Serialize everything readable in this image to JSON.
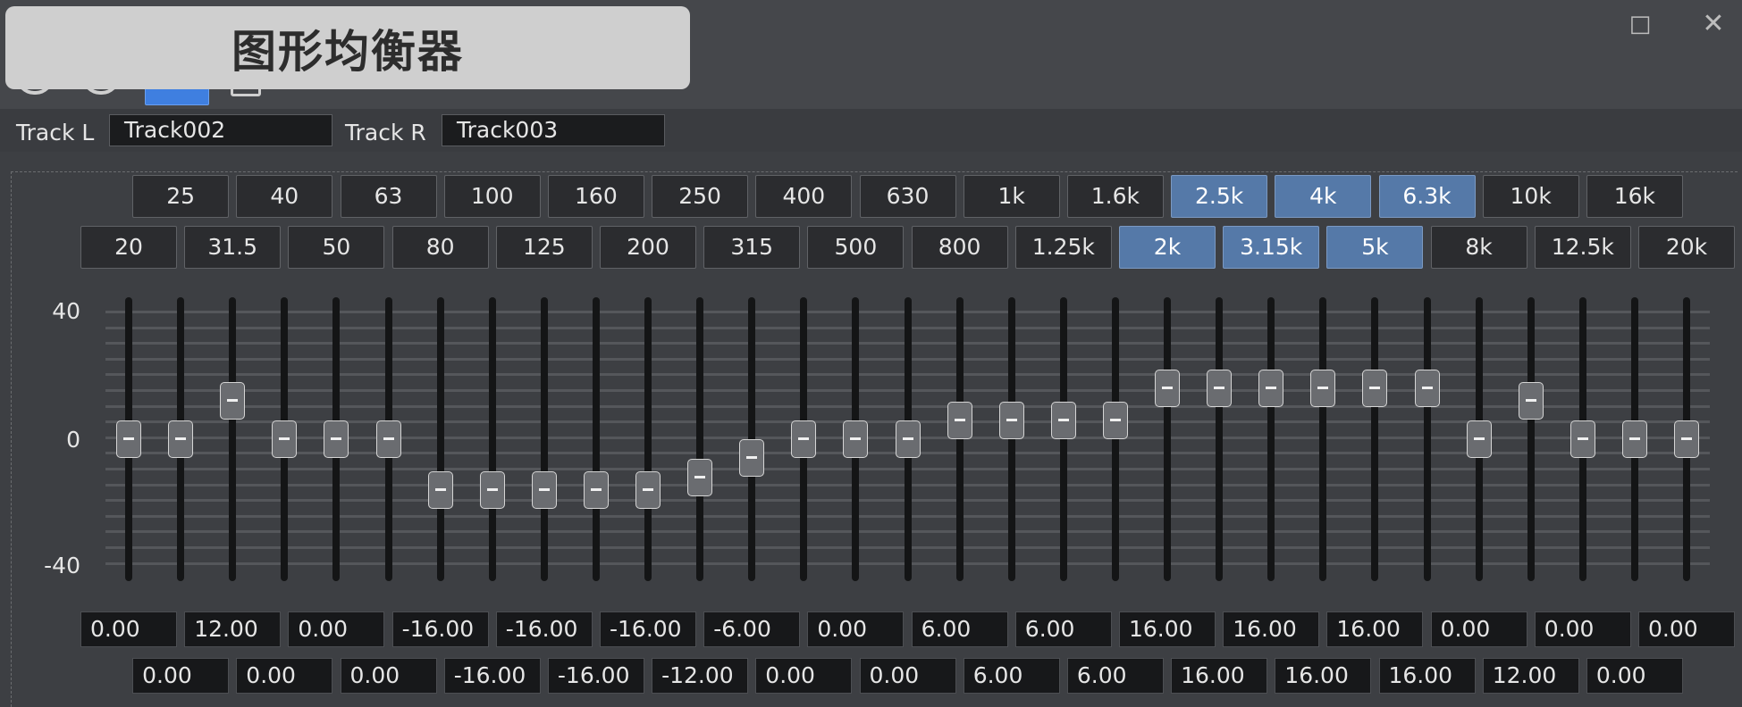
{
  "window": {
    "title": "图形均衡器"
  },
  "toolbar": {
    "undo_icon": "undo-icon",
    "redo_icon": "redo-icon",
    "active_icon": "active-mode-icon",
    "copy_icon": "copy-icon"
  },
  "window_controls": {
    "maximize": "□",
    "close": "✕"
  },
  "tracks": {
    "left_label": "Track L",
    "left_value": "Track002",
    "right_label": "Track R",
    "right_value": "Track003"
  },
  "scale": {
    "top": "40",
    "mid": "0",
    "bottom": "-40",
    "max": 40,
    "min": -40
  },
  "colors": {
    "selected": "#5579a8",
    "accent": "#3f7fe0"
  },
  "bands": [
    {
      "freq": "20",
      "gain": "0.00",
      "value": 0,
      "row": "lower",
      "selected": false
    },
    {
      "freq": "25",
      "gain": "0.00",
      "value": 0,
      "row": "upper",
      "selected": false
    },
    {
      "freq": "31.5",
      "gain": "12.00",
      "value": 12,
      "row": "lower",
      "selected": false
    },
    {
      "freq": "40",
      "gain": "0.00",
      "value": 0,
      "row": "upper",
      "selected": false
    },
    {
      "freq": "50",
      "gain": "0.00",
      "value": 0,
      "row": "lower",
      "selected": false
    },
    {
      "freq": "63",
      "gain": "0.00",
      "value": 0,
      "row": "upper",
      "selected": false
    },
    {
      "freq": "80",
      "gain": "-16.00",
      "value": -16,
      "row": "lower",
      "selected": false
    },
    {
      "freq": "100",
      "gain": "-16.00",
      "value": -16,
      "row": "upper",
      "selected": false
    },
    {
      "freq": "125",
      "gain": "-16.00",
      "value": -16,
      "row": "lower",
      "selected": false
    },
    {
      "freq": "160",
      "gain": "-16.00",
      "value": -16,
      "row": "upper",
      "selected": false
    },
    {
      "freq": "200",
      "gain": "-16.00",
      "value": -16,
      "row": "lower",
      "selected": false
    },
    {
      "freq": "250",
      "gain": "-12.00",
      "value": -12,
      "row": "upper",
      "selected": false
    },
    {
      "freq": "315",
      "gain": "-6.00",
      "value": -6,
      "row": "lower",
      "selected": false
    },
    {
      "freq": "400",
      "gain": "0.00",
      "value": 0,
      "row": "upper",
      "selected": false
    },
    {
      "freq": "500",
      "gain": "0.00",
      "value": 0,
      "row": "lower",
      "selected": false
    },
    {
      "freq": "630",
      "gain": "0.00",
      "value": 0,
      "row": "upper",
      "selected": false
    },
    {
      "freq": "800",
      "gain": "6.00",
      "value": 6,
      "row": "lower",
      "selected": false
    },
    {
      "freq": "1k",
      "gain": "6.00",
      "value": 6,
      "row": "upper",
      "selected": false
    },
    {
      "freq": "1.25k",
      "gain": "6.00",
      "value": 6,
      "row": "lower",
      "selected": false
    },
    {
      "freq": "1.6k",
      "gain": "6.00",
      "value": 6,
      "row": "upper",
      "selected": false
    },
    {
      "freq": "2k",
      "gain": "16.00",
      "value": 16,
      "row": "lower",
      "selected": true
    },
    {
      "freq": "2.5k",
      "gain": "16.00",
      "value": 16,
      "row": "upper",
      "selected": true
    },
    {
      "freq": "3.15k",
      "gain": "16.00",
      "value": 16,
      "row": "lower",
      "selected": true
    },
    {
      "freq": "4k",
      "gain": "16.00",
      "value": 16,
      "row": "upper",
      "selected": true
    },
    {
      "freq": "5k",
      "gain": "16.00",
      "value": 16,
      "row": "lower",
      "selected": true
    },
    {
      "freq": "6.3k",
      "gain": "16.00",
      "value": 16,
      "row": "upper",
      "selected": true
    },
    {
      "freq": "8k",
      "gain": "0.00",
      "value": 0,
      "row": "lower",
      "selected": false
    },
    {
      "freq": "10k",
      "gain": "12.00",
      "value": 12,
      "row": "upper",
      "selected": false
    },
    {
      "freq": "12.5k",
      "gain": "0.00",
      "value": 0,
      "row": "lower",
      "selected": false
    },
    {
      "freq": "16k",
      "gain": "0.00",
      "value": 0,
      "row": "upper",
      "selected": false
    },
    {
      "freq": "20k",
      "gain": "0.00",
      "value": 0,
      "row": "lower",
      "selected": false
    }
  ]
}
